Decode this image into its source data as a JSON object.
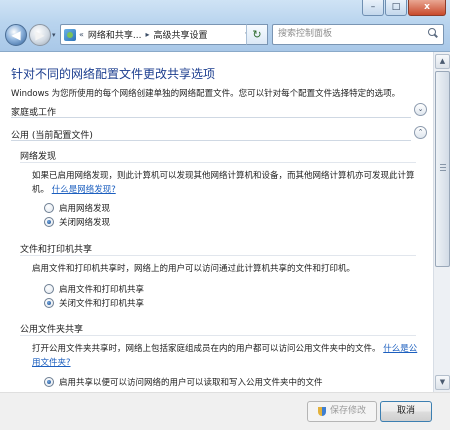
{
  "window": {
    "minimize_label": "–",
    "maximize_label": "□",
    "close_label": "x"
  },
  "nav": {
    "back_glyph": "◀",
    "forward_glyph": "▶",
    "dropdown_glyph": "▾"
  },
  "address": {
    "prefix": "«",
    "crumbs": [
      "网络和共享...",
      "高级共享设置"
    ],
    "separator": "▸",
    "dropdown_glyph": "▾",
    "refresh_glyph": "↻"
  },
  "search": {
    "placeholder": "搜索控制面板"
  },
  "page": {
    "title": "针对不同的网络配置文件更改共享选项",
    "intro": "Windows 为您所使用的每个网络创建单独的网络配置文件。您可以针对每个配置文件选择特定的选项。"
  },
  "profiles": {
    "home_work": "家庭或工作",
    "public": "公用 (当前配置文件)"
  },
  "chevrons": {
    "expand": "⌄",
    "collapse": "⌃"
  },
  "sections": {
    "discovery": {
      "heading": "网络发现",
      "description": "如果已启用网络发现，则此计算机可以发现其他网络计算机和设备，而其他网络计算机亦可发现此计算机。",
      "link": "什么是网络发现?",
      "options": [
        "启用网络发现",
        "关闭网络发现"
      ],
      "selected": 1
    },
    "file_printer": {
      "heading": "文件和打印机共享",
      "description": "启用文件和打印机共享时，网络上的用户可以访问通过此计算机共享的文件和打印机。",
      "options": [
        "启用文件和打印机共享",
        "关闭文件和打印机共享"
      ],
      "selected": 1
    },
    "public_folder": {
      "heading": "公用文件夹共享",
      "description": "打开公用文件夹共享时，网络上包括家庭组成员在内的用户都可以访问公用文件夹中的文件。",
      "link": "什么是公用文件夹?",
      "options": [
        "启用共享以便可以访问网络的用户可以读取和写入公用文件夹中的文件"
      ],
      "selected": 0
    }
  },
  "scrollbar": {
    "up_glyph": "▲",
    "down_glyph": "▼"
  },
  "footer": {
    "save_label": "保存修改",
    "cancel_label": "取消"
  }
}
